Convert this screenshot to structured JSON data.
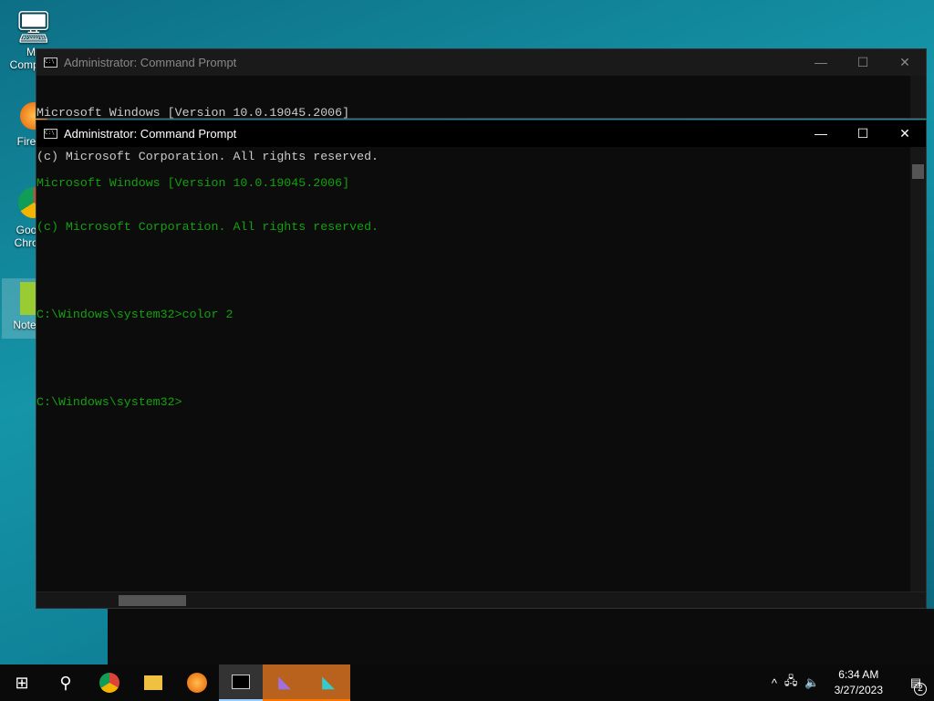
{
  "desktop": {
    "icons": [
      {
        "label": "My Computer",
        "icon": "computer-icon"
      },
      {
        "label": "Firefox",
        "icon": "firefox-icon"
      },
      {
        "label": "Google Chrome",
        "icon": "chrome-icon"
      },
      {
        "label": "Notepad",
        "icon": "notepad-icon"
      }
    ]
  },
  "back_window": {
    "title": "Administrator:  Command Prompt",
    "lines": [
      "Microsoft Windows [Version 10.0.19045.2006]",
      "(c) Microsoft Corporation. All rights reserved."
    ]
  },
  "front_window": {
    "title": "Administrator:  Command Prompt",
    "text_color": "#13a10e",
    "lines": [
      "Microsoft Windows [Version 10.0.19045.2006]",
      "(c) Microsoft Corporation. All rights reserved.",
      "",
      "C:\\Windows\\system32>color 2",
      "",
      "C:\\Windows\\system32>"
    ]
  },
  "taskbar": {
    "time": "6:34 AM",
    "date": "3/27/2023",
    "notification_count": "2"
  }
}
